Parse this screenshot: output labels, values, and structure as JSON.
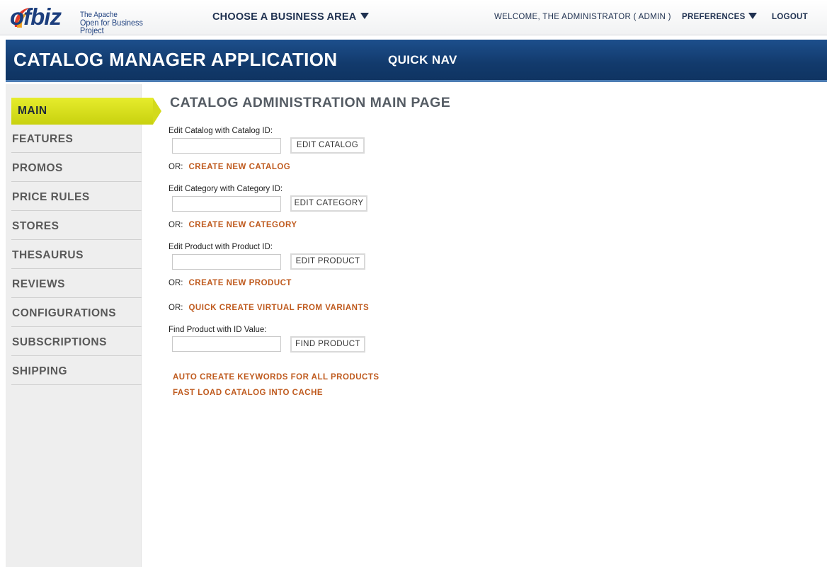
{
  "header": {
    "logo_text": "ofbiz",
    "logo_sub_line1": "The Apache",
    "logo_sub_line2": "Open for Business Project",
    "business_area": "CHOOSE A BUSINESS AREA",
    "welcome": "WELCOME, THE ADMINISTRATOR ( ADMIN )",
    "preferences": "PREFERENCES",
    "logout": "LOGOUT"
  },
  "appbar": {
    "title": "CATALOG MANAGER APPLICATION",
    "quick_nav": "QUICK NAV"
  },
  "sidebar": {
    "items": [
      {
        "label": "MAIN",
        "active": true
      },
      {
        "label": "FEATURES",
        "active": false
      },
      {
        "label": "PROMOS",
        "active": false
      },
      {
        "label": "PRICE RULES",
        "active": false
      },
      {
        "label": "STORES",
        "active": false
      },
      {
        "label": "THESAURUS",
        "active": false
      },
      {
        "label": "REVIEWS",
        "active": false
      },
      {
        "label": "CONFIGURATIONS",
        "active": false
      },
      {
        "label": "SUBSCRIPTIONS",
        "active": false
      },
      {
        "label": "SHIPPING",
        "active": false
      }
    ]
  },
  "main": {
    "title": "CATALOG ADMINISTRATION MAIN PAGE",
    "or_label": "OR:",
    "catalog": {
      "label": "Edit Catalog with Catalog ID:",
      "value": "",
      "button": "EDIT CATALOG",
      "create_link": "CREATE NEW CATALOG"
    },
    "category": {
      "label": "Edit Category with Category ID:",
      "value": "",
      "button": "EDIT CATEGORY",
      "create_link": "CREATE NEW CATEGORY"
    },
    "product": {
      "label": "Edit Product with Product ID:",
      "value": "",
      "button": "EDIT PRODUCT",
      "create_link": "CREATE NEW PRODUCT"
    },
    "quick_create_link": "QUICK CREATE VIRTUAL FROM VARIANTS",
    "find": {
      "label": "Find Product with ID Value:",
      "value": "",
      "button": "FIND PRODUCT"
    },
    "auto_keywords_link": "AUTO CREATE KEYWORDS FOR ALL PRODUCTS",
    "fast_load_link": "FAST LOAD CATALOG INTO CACHE"
  },
  "colors": {
    "header_blue": "#123a6c",
    "active_nav": "#d4dc14",
    "link_orange": "#bf5a1e",
    "nav_text": "#595959"
  }
}
